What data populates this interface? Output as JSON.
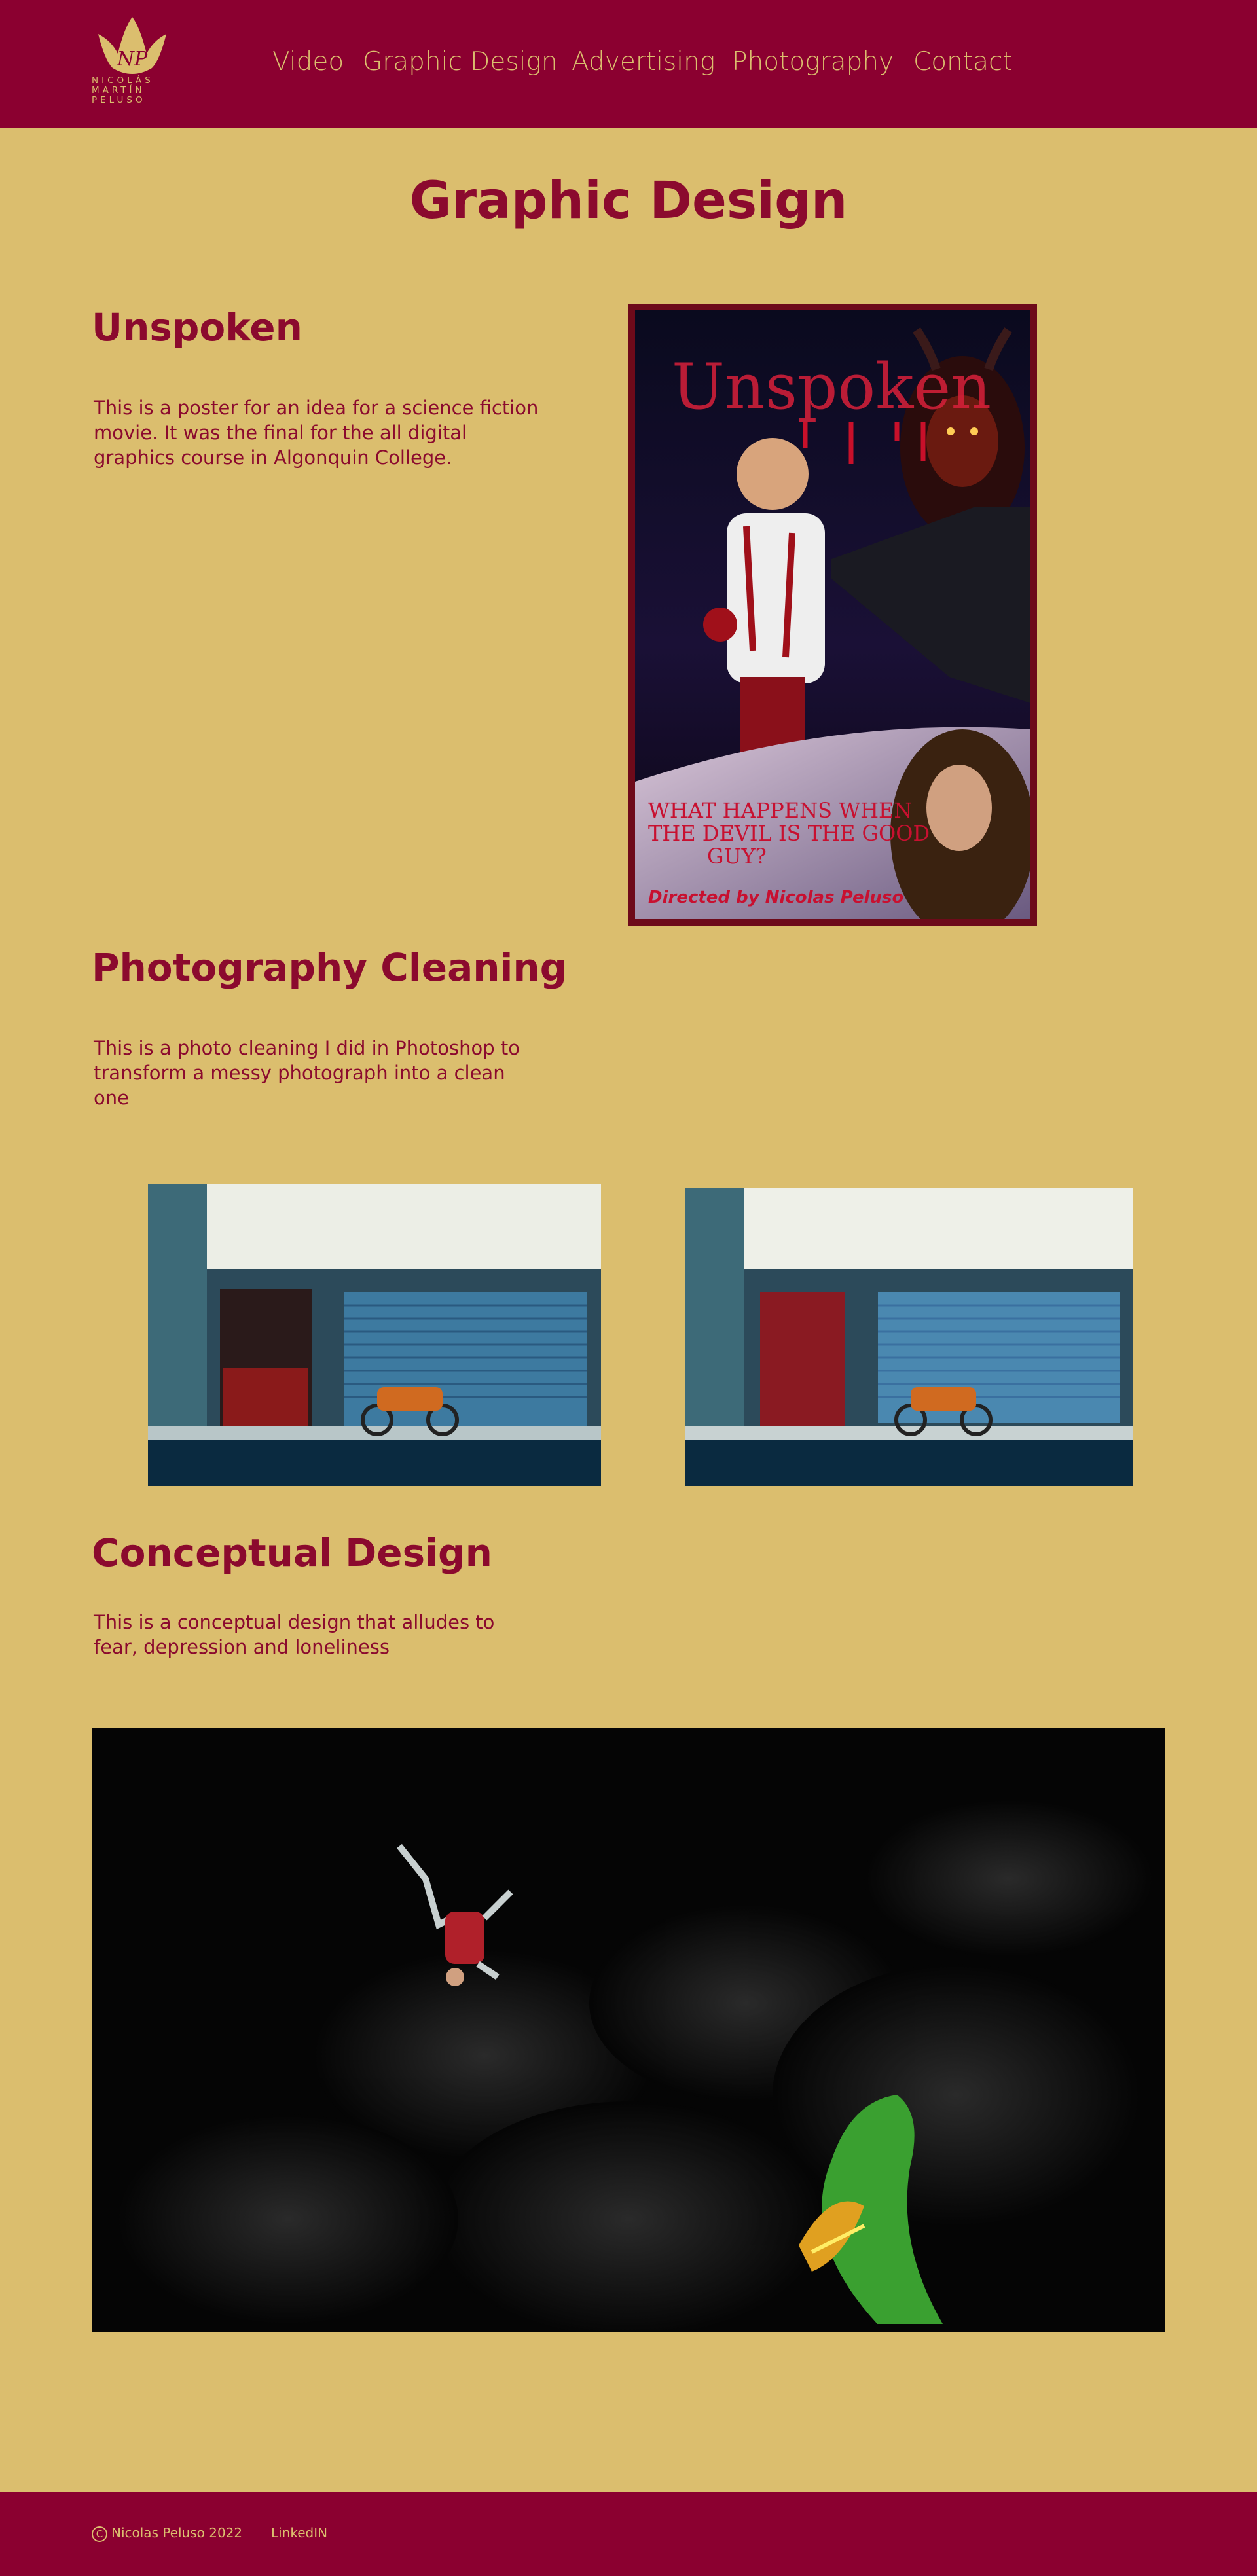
{
  "header": {
    "logo_text": [
      "NICOLÁS",
      "MARTÍN",
      "PELUSO"
    ],
    "logo_monogram": "NP",
    "nav": [
      {
        "label": "Video"
      },
      {
        "label": "Graphic Design"
      },
      {
        "label": "Advertising"
      },
      {
        "label": "Photography"
      },
      {
        "label": "Contact"
      }
    ]
  },
  "main": {
    "page_title": "Graphic Design",
    "sections": [
      {
        "title": "Unspoken",
        "description": "This is a poster for an idea for a science fiction movie. It was the final for the all digital graphics course in Algonquin College.",
        "poster": {
          "title": "Unspoken",
          "tagline": [
            "WHAT HAPPENS WHEN",
            "THE DEVIL IS THE GOOD",
            "GUY?"
          ],
          "credit": "Directed by Nicolas Peluso"
        }
      },
      {
        "title": "Photography Cleaning",
        "description": "This is a photo cleaning I did in Photoshop to transform a messy photograph into a clean one"
      },
      {
        "title": "Conceptual Design",
        "description": "This is a conceptual design that alludes to fear, depression and loneliness"
      }
    ]
  },
  "footer": {
    "copyright_symbol": "C",
    "copyright": "Nicolas Peluso 2022",
    "link": "LinkedIN"
  },
  "colors": {
    "primary": "#8b0030",
    "background": "#dbbe6e",
    "accent_text": "#8b0a2e"
  }
}
